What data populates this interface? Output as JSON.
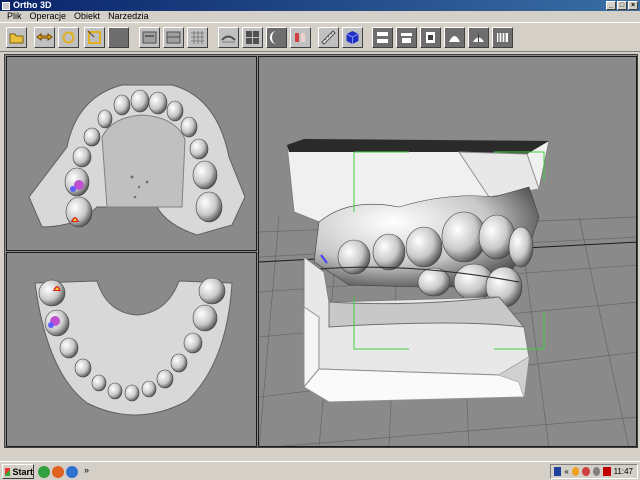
{
  "window": {
    "title": "Ortho 3D",
    "controls": {
      "minimize": "_",
      "maximize": "□",
      "close": "×"
    }
  },
  "menu": {
    "items": [
      {
        "label": "Plik"
      },
      {
        "label": "Operacje"
      },
      {
        "label": "Obiekt"
      },
      {
        "label": "Narzedzia"
      }
    ]
  },
  "toolbar": {
    "buttons": [
      {
        "icon": "open-folder-icon"
      },
      {
        "icon": "move-arrows-icon"
      },
      {
        "icon": "rotate-icon"
      },
      {
        "icon": "scale-icon"
      },
      {
        "icon": "blank-icon"
      },
      {
        "icon": "view-single-icon"
      },
      {
        "icon": "view-split-icon"
      },
      {
        "icon": "view-grid-icon"
      },
      {
        "icon": "occlusion-icon"
      },
      {
        "icon": "layout-four-icon"
      },
      {
        "icon": "contrast-icon"
      },
      {
        "icon": "teeth-icon"
      },
      {
        "icon": "ruler-icon"
      },
      {
        "icon": "cube-icon"
      },
      {
        "icon": "view-top-icon"
      },
      {
        "icon": "view-bottom-icon"
      },
      {
        "icon": "view-left-icon"
      },
      {
        "icon": "view-right-icon"
      },
      {
        "icon": "view-front-icon"
      },
      {
        "icon": "view-back-icon"
      }
    ]
  },
  "viewports": {
    "upper_jaw": "upper-jaw-viewport",
    "lower_jaw": "lower-jaw-viewport",
    "model_3d": "3d-model-viewport"
  },
  "taskbar": {
    "start_label": "Start",
    "chevron": "»",
    "tray_chevron": "«",
    "clock": "11:47"
  }
}
